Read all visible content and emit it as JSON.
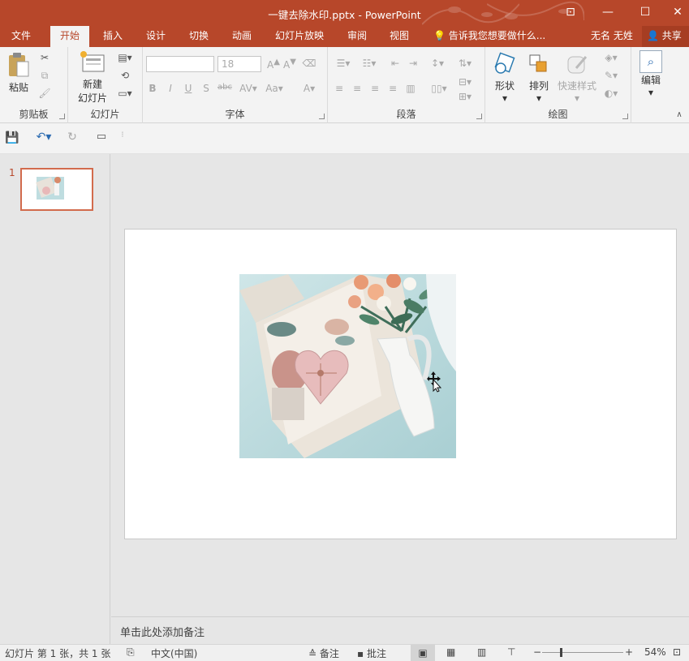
{
  "title": "一键去除水印.pptx - PowerPoint",
  "window_controls": {
    "ribbon_display": "⊡",
    "minimize": "—",
    "maximize": "☐",
    "close": "✕"
  },
  "tabs": [
    "文件",
    "开始",
    "插入",
    "设计",
    "切换",
    "动画",
    "幻灯片放映",
    "审阅",
    "视图"
  ],
  "active_tab": "开始",
  "tell_me": "告诉我您想要做什么...",
  "user_name": "无名 无姓",
  "share_label": "共享",
  "ribbon": {
    "clipboard": {
      "paste": "粘贴",
      "label": "剪贴板"
    },
    "slides": {
      "new_slide_line1": "新建",
      "new_slide_line2": "幻灯片",
      "label": "幻灯片"
    },
    "font": {
      "font_name": "",
      "font_size": "18",
      "label": "字体"
    },
    "paragraph": {
      "label": "段落"
    },
    "drawing": {
      "shapes": "形状",
      "arrange": "排列",
      "quick_styles": "快速样式",
      "label": "绘图"
    },
    "editing": {
      "label": "编辑"
    }
  },
  "slide_number": "1",
  "notes_placeholder": "单击此处添加备注",
  "status": {
    "slide_info": "幻灯片 第 1 张，共 1 张",
    "language": "中文(中国)",
    "notes_btn": "备注",
    "comments_btn": "批注",
    "zoom": "54%"
  },
  "colors": {
    "accent": "#b7472a",
    "ribbon_bg": "#f3f3f3",
    "app_bg": "#e6e6e6"
  }
}
